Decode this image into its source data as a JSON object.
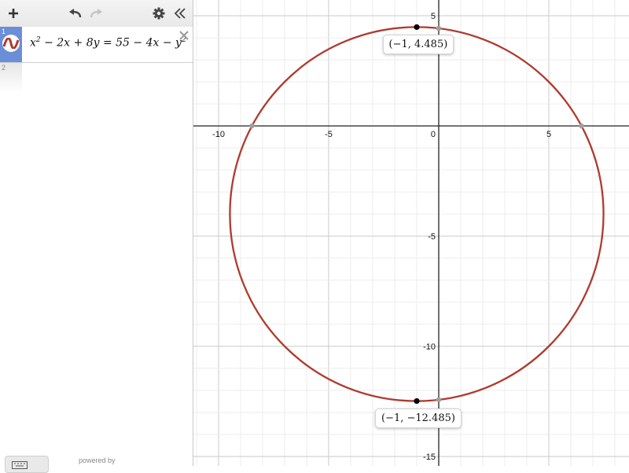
{
  "toolbar": {
    "add_icon": "plus-icon",
    "undo_icon": "undo-icon",
    "redo_icon": "redo-icon",
    "settings_icon": "gear-icon",
    "collapse_icon": "double-chevron-left-icon"
  },
  "expressions": [
    {
      "number": "1",
      "color": "#b03a2e",
      "parts": {
        "a": "x",
        "a_exp": "2",
        "b": " − 2x + 8y = 55 − 4x − y",
        "b_exp": "2"
      }
    }
  ],
  "empty_row_number": "2",
  "footer": {
    "powered_by": "powered by"
  },
  "graph": {
    "x_ticks": [
      "-10",
      "-5",
      "0",
      "5"
    ],
    "y_ticks": [
      "5",
      "-5",
      "-10",
      "-15"
    ],
    "points": [
      {
        "label": "(−1, 4.485)",
        "x": -1,
        "y": 4.485
      },
      {
        "label": "(−1, −12.485)",
        "x": -1,
        "y": -12.485
      }
    ]
  },
  "chart_data": {
    "type": "scatter",
    "title": "",
    "xlabel": "",
    "ylabel": "",
    "xlim": [
      -11,
      9
    ],
    "ylim": [
      -15.5,
      5.5
    ],
    "curve": {
      "equation": "x^2 − 2x + 8y = 55 − 4x − y^2",
      "shape": "circle",
      "color": "#b03a2e"
    },
    "series": [
      {
        "x": [
          -1,
          -1
        ],
        "y": [
          4.485,
          -12.485
        ]
      }
    ],
    "grid": true
  }
}
